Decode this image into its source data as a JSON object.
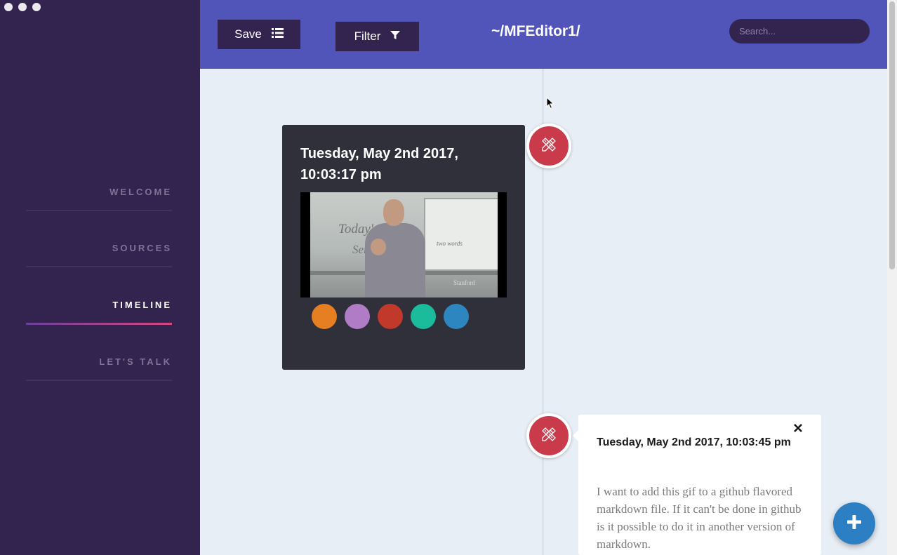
{
  "window": {
    "controls": [
      "close",
      "minimize",
      "maximize"
    ]
  },
  "sidebar": {
    "items": [
      {
        "label": "WELCOME",
        "active": false
      },
      {
        "label": "SOURCES",
        "active": false
      },
      {
        "label": "TIMELINE",
        "active": true
      },
      {
        "label": "LET'S TALK",
        "active": false
      }
    ]
  },
  "header": {
    "save_label": "Save",
    "save_icon": "list-icon",
    "filter_label": "Filter",
    "filter_icon": "funnel-icon",
    "path_title": "~/MFEditor1/",
    "search_placeholder": "Search..."
  },
  "timeline": {
    "entries": [
      {
        "date": "Tuesday, May 2nd 2017, 10:03:17 pm",
        "icon": "edit-tools-icon",
        "media": {
          "board_text": "Today's",
          "board_text_2": "Series",
          "board_note": "two words",
          "watermark": "Stanford"
        },
        "swatch_colors": [
          "#e67e22",
          "#b07cc6",
          "#c0392b",
          "#1abc9c",
          "#2e86c1"
        ]
      },
      {
        "date": "Tuesday, May 2nd 2017, 10:03:45 pm",
        "icon": "edit-tools-icon",
        "body": "I want to add this gif to a github flavored markdown file. If it can't be done in github is it possible to do it in another version of markdown."
      }
    ]
  },
  "fab": {
    "icon": "plus-icon"
  },
  "colors": {
    "sidebar": "#32244f",
    "header": "#5154b8",
    "accent": "#c93a4a",
    "fab": "#2d7fc3"
  }
}
